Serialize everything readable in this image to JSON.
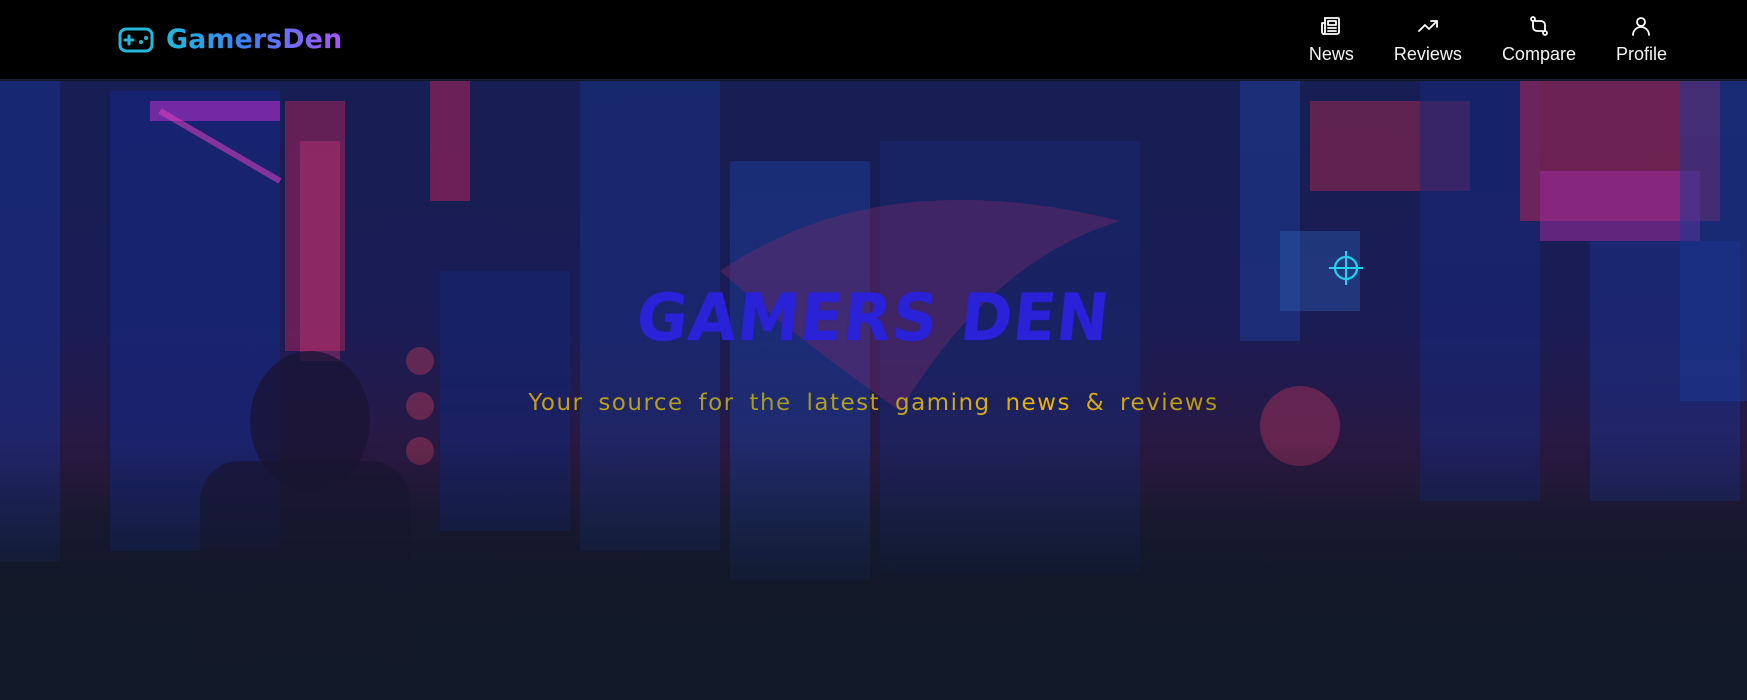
{
  "brand": {
    "name": "GamersDen",
    "icon": "gamepad-icon"
  },
  "nav": {
    "items": [
      {
        "label": "News",
        "icon": "newspaper-icon"
      },
      {
        "label": "Reviews",
        "icon": "trending-up-icon"
      },
      {
        "label": "Compare",
        "icon": "compare-arrows-icon"
      },
      {
        "label": "Profile",
        "icon": "user-icon"
      }
    ]
  },
  "hero": {
    "title": "GAMERS DEN",
    "subtitle": "Your source for the latest gaming news & reviews"
  },
  "colors": {
    "header_bg": "#000000",
    "brand_gradient_start": "#22b8d9",
    "brand_gradient_end": "#a855f7",
    "hero_title": "#2a22d9",
    "hero_subtitle": "#eab308",
    "crosshair": "#22d3ee",
    "page_bg": "#111827"
  }
}
